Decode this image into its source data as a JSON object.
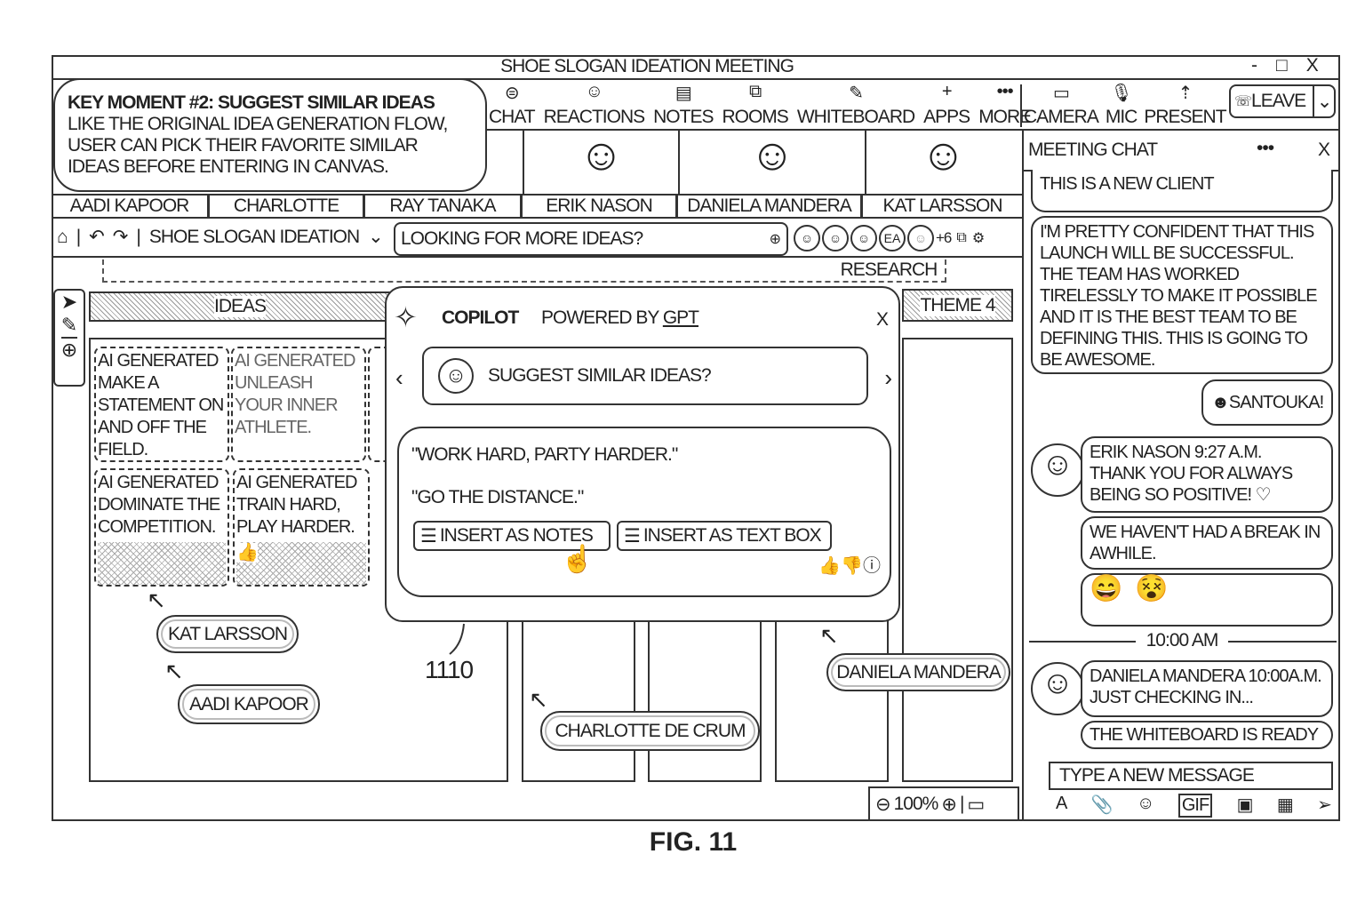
{
  "window": {
    "title": "SHOE SLOGAN IDEATION MEETING",
    "controls": [
      "-",
      "□",
      "X"
    ]
  },
  "toolbar": {
    "items": [
      {
        "label": "CHAT",
        "icon": "chat-icon",
        "glyph": "⊜"
      },
      {
        "label": "REACTIONS",
        "icon": "reactions-icon",
        "glyph": "☺"
      },
      {
        "label": "NOTES",
        "icon": "notes-icon",
        "glyph": "▤"
      },
      {
        "label": "ROOMS",
        "icon": "rooms-icon",
        "glyph": "⧉"
      },
      {
        "label": "WHITEBOARD",
        "icon": "whiteboard-icon",
        "glyph": "✎"
      },
      {
        "label": "APPS",
        "icon": "plus-icon",
        "glyph": "+"
      },
      {
        "label": "MORE",
        "icon": "more-icon",
        "glyph": "•••"
      }
    ],
    "media": [
      {
        "label": "CAMERA",
        "icon": "camera-icon",
        "glyph": "▭"
      },
      {
        "label": "MIC",
        "icon": "mic-icon",
        "glyph": "🎙"
      },
      {
        "label": "PRESENT",
        "icon": "present-icon",
        "glyph": "⇡"
      }
    ],
    "leave": "LEAVE"
  },
  "callout": {
    "title": "KEY MOMENT #2: SUGGEST SIMILAR IDEAS",
    "body": "LIKE THE ORIGINAL IDEA GENERATION FLOW, USER CAN PICK THEIR FAVORITE SIMILAR IDEAS BEFORE ENTERING IN CANVAS."
  },
  "participants": [
    "AADI KAPOOR",
    "CHARLOTTE",
    "RAY TANAKA",
    "ERIK NASON",
    "DANIELA MANDERA",
    "KAT LARSSON"
  ],
  "nav": {
    "board_name": "SHOE SLOGAN IDEATION",
    "search_placeholder": "LOOKING FOR MORE IDEAS?",
    "avatar_initials": "EA",
    "more_count": "+6"
  },
  "canvas": {
    "research": "RESEARCH",
    "ideas_header": "IDEAS",
    "theme": "THEME 4",
    "cards": [
      {
        "tag": "AI GENERATED",
        "text": "MAKE A STATEMENT ON AND OFF THE FIELD."
      },
      {
        "tag": "AI GENERATED",
        "text": "UNLEASH YOUR INNER ATHLETE."
      },
      {
        "tag": "AI GENERATED",
        "text": "DOMINATE THE COMPETITION."
      },
      {
        "tag": "AI GENERATED",
        "text": "TRAIN HARD, PLAY HARDER."
      }
    ],
    "cursors": [
      "KAT LARSSON",
      "AADI KAPOOR",
      "CHARLOTTE DE CRUM",
      "DANIELA MANDERA"
    ],
    "reference": "1110",
    "zoom": "100%"
  },
  "copilot": {
    "title": "COPILOT",
    "powered_by": "POWERED BY",
    "brand": "GPT",
    "close": "X",
    "prompt": "SUGGEST SIMILAR IDEAS?",
    "suggestions": [
      "\"WORK HARD, PARTY HARDER.\"",
      "\"GO THE DISTANCE.\""
    ],
    "insert_notes": "INSERT AS NOTES",
    "insert_textbox": "INSERT AS TEXT BOX"
  },
  "chat": {
    "title": "MEETING CHAT",
    "close": "X",
    "messages": [
      "THIS IS A NEW CLIENT",
      "I'M PRETTY CONFIDENT THAT THIS LAUNCH WILL BE SUCCESSFUL. THE TEAM HAS WORKED TIRELESSLY TO MAKE IT POSSIBLE AND IT IS THE BEST TEAM TO BE DEFINING THIS. THIS IS GOING TO BE AWESOME.",
      "SANTOUKA!"
    ],
    "erik": {
      "header": "ERIK NASON  9:27 A.M.",
      "msg1": "THANK YOU FOR ALWAYS BEING SO POSITIVE! ♡",
      "msg2": "WE HAVEN'T HAD A BREAK IN AWHILE."
    },
    "divider": "10:00 AM",
    "daniela": {
      "header": "DANIELA MANDERA 10:00A.M.",
      "msg1": "JUST CHECKING IN...",
      "msg2": "THE WHITEBOARD IS READY"
    },
    "input_placeholder": "TYPE A NEW MESSAGE",
    "gif": "GIF"
  },
  "caption": "FIG. 11"
}
